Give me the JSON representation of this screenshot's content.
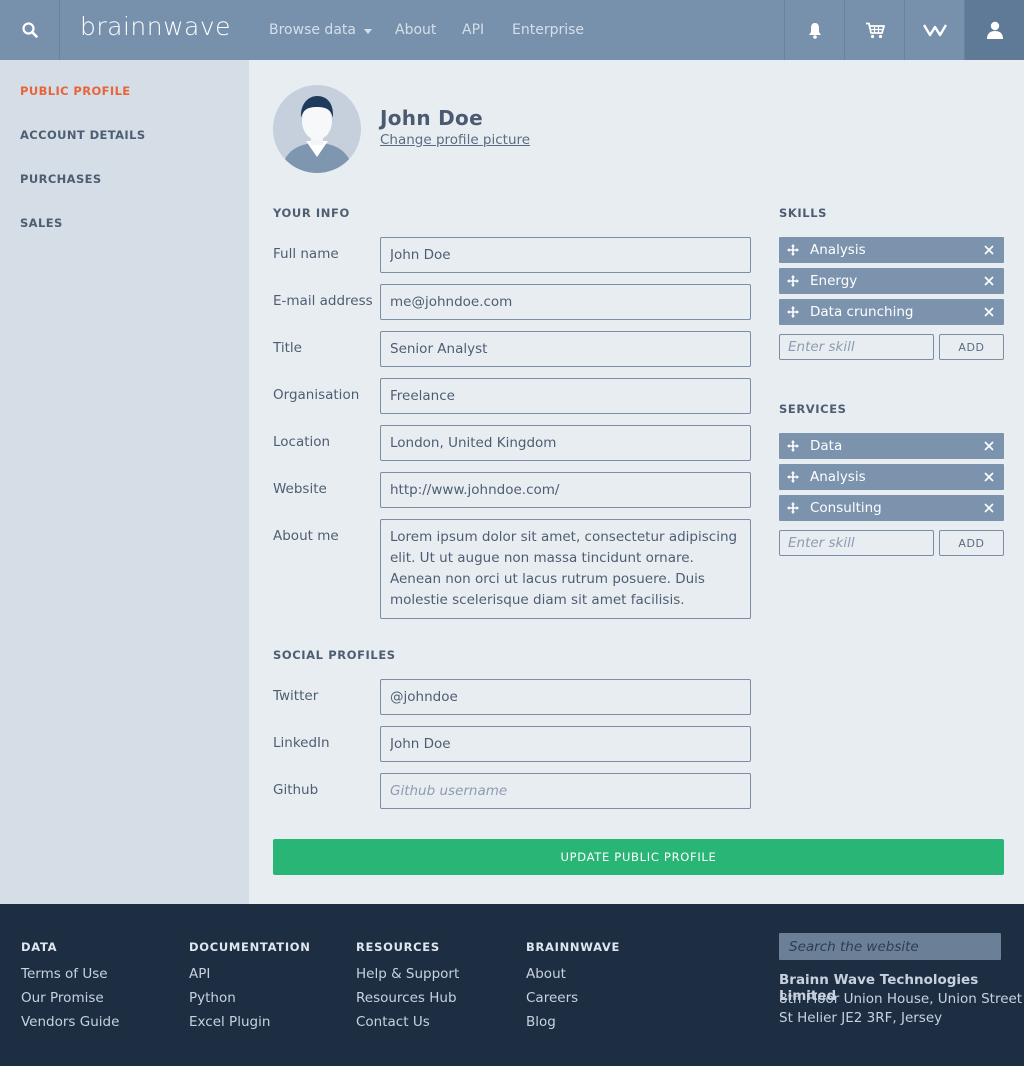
{
  "header": {
    "logo": "brainnwave",
    "nav": [
      {
        "label": "Browse data"
      },
      {
        "label": "About"
      },
      {
        "label": "API"
      },
      {
        "label": "Enterprise"
      }
    ],
    "icons": [
      "search-icon",
      "bell-icon",
      "cart-icon",
      "brainnwave-icon",
      "user-icon"
    ]
  },
  "sidebar": {
    "items": [
      {
        "label": "PUBLIC PROFILE",
        "active": true
      },
      {
        "label": "ACCOUNT DETAILS"
      },
      {
        "label": "PURCHASES"
      },
      {
        "label": "SALES"
      }
    ]
  },
  "profile": {
    "name": "John Doe",
    "change_picture": "Change profile picture"
  },
  "your_info": {
    "heading": "YOUR INFO",
    "fields": [
      {
        "label": "Full name",
        "value": "John Doe"
      },
      {
        "label": "E-mail address",
        "value": "me@johndoe.com"
      },
      {
        "label": "Title",
        "value": "Senior Analyst"
      },
      {
        "label": "Organisation",
        "value": "Freelance"
      },
      {
        "label": "Location",
        "value": "London, United Kingdom"
      },
      {
        "label": "Website",
        "value": "http://www.johndoe.com/"
      },
      {
        "label": "About me",
        "value": "Lorem ipsum dolor sit amet, consectetur adipiscing elit. Ut ut augue non massa tincidunt ornare. Aenean non orci ut lacus rutrum posuere. Duis molestie scelerisque diam sit amet facilisis."
      }
    ]
  },
  "social": {
    "heading": "SOCIAL PROFILES",
    "fields": [
      {
        "label": "Twitter",
        "value": "@johndoe"
      },
      {
        "label": "LinkedIn",
        "value": "John Doe"
      },
      {
        "label": "Github",
        "value": "",
        "placeholder": "Github username"
      }
    ]
  },
  "skills": {
    "heading": "SKILLS",
    "items": [
      "Analysis",
      "Energy",
      "Data crunching"
    ],
    "input_placeholder": "Enter skill",
    "add_label": "ADD"
  },
  "services": {
    "heading": "SERVICES",
    "items": [
      "Data",
      "Analysis",
      "Consulting"
    ],
    "input_placeholder": "Enter skill",
    "add_label": "ADD"
  },
  "update_button": "UPDATE PUBLIC PROFILE",
  "footer": {
    "columns": [
      {
        "heading": "DATA",
        "links": [
          "Terms of Use",
          "Our Promise",
          "Vendors Guide"
        ]
      },
      {
        "heading": "DOCUMENTATION",
        "links": [
          "API",
          "Python",
          "Excel Plugin"
        ]
      },
      {
        "heading": "RESOURCES",
        "links": [
          "Help & Support",
          "Resources Hub",
          "Contact Us"
        ]
      },
      {
        "heading": "BRAINNWAVE",
        "links": [
          "About",
          "Careers",
          "Blog"
        ]
      }
    ],
    "search_placeholder": "Search the website",
    "company": "Brainn Wave Technologies Limited",
    "address": [
      "8th Floor Union House, Union Street",
      "St Helier JE2 3RF, Jersey"
    ]
  },
  "colors": {
    "topbar": "#7790ab",
    "accent": "#e8643a",
    "primary_button": "#28b575",
    "tag": "#7b93ad",
    "footer": "#1d2e43"
  }
}
